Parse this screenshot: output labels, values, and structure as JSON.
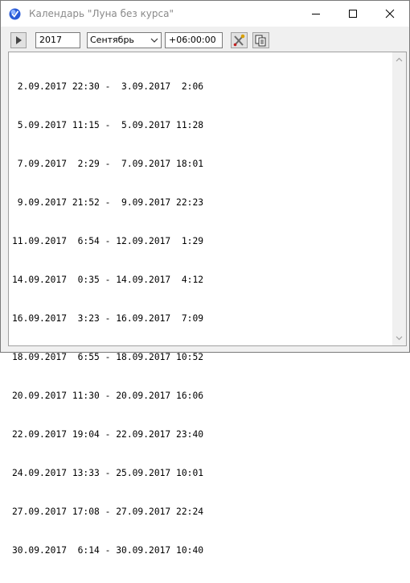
{
  "window": {
    "title": "Календарь \"Луна без курса\"",
    "icons": [
      "app-icon",
      "minimize-icon",
      "maximize-icon",
      "close-icon"
    ]
  },
  "toolbar": {
    "play_icon": "play-icon",
    "year": "2017",
    "month": "Сентябрь",
    "timezone": "+06:00:00",
    "tools_icon": "tools-icon",
    "copy_icon": "copy-icon"
  },
  "periods": [
    " 2.09.2017 22:30 -  3.09.2017  2:06",
    " 5.09.2017 11:15 -  5.09.2017 11:28",
    " 7.09.2017  2:29 -  7.09.2017 18:01",
    " 9.09.2017 21:52 -  9.09.2017 22:23",
    "11.09.2017  6:54 - 12.09.2017  1:29",
    "14.09.2017  0:35 - 14.09.2017  4:12",
    "16.09.2017  3:23 - 16.09.2017  7:09",
    "18.09.2017  6:55 - 18.09.2017 10:52",
    "20.09.2017 11:30 - 20.09.2017 16:06",
    "22.09.2017 19:04 - 22.09.2017 23:40",
    "24.09.2017 13:33 - 25.09.2017 10:01",
    "27.09.2017 17:08 - 27.09.2017 22:24",
    "30.09.2017  6:14 - 30.09.2017 10:40"
  ],
  "colors": {
    "title_text": "#8a8a8a",
    "app_icon": "#2a5bd7"
  }
}
